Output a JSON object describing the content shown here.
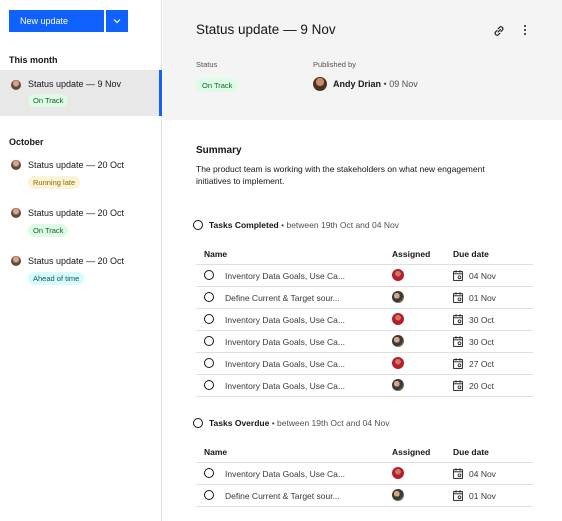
{
  "sidebar": {
    "new_button_label": "New update",
    "sections": [
      {
        "title": "This month",
        "items": [
          {
            "title": "Status update — 9 Nov",
            "tag": "On Track",
            "tag_color": "green",
            "active": true
          }
        ]
      },
      {
        "title": "October",
        "items": [
          {
            "title": "Status update — 20 Oct",
            "tag": "Running late",
            "tag_color": "yellow",
            "active": false
          },
          {
            "title": "Status update — 20 Oct",
            "tag": "On Track",
            "tag_color": "green",
            "active": false
          },
          {
            "title": "Status update — 20 Oct",
            "tag": "Ahead of time",
            "tag_color": "cyan",
            "active": false
          }
        ]
      }
    ]
  },
  "header": {
    "title": "Status update — 9 Nov",
    "status_label": "Status",
    "status_value": "On Track",
    "published_label": "Published by",
    "author": "Andy Drian",
    "date": "09 Nov"
  },
  "summary": {
    "title": "Summary",
    "text": "The product team is working with the stakeholders on what new engagement initiatives to implement."
  },
  "columns": {
    "name": "Name",
    "assigned": "Assigned",
    "due": "Due date"
  },
  "groups": [
    {
      "title": "Tasks Completed",
      "subtitle": "between 19th Oct and 04 Nov",
      "rows": [
        {
          "task": "Inventory Data Goals, Use Ca...",
          "avatar": "a1",
          "due": "04 Nov"
        },
        {
          "task": "Define Current & Target sour...",
          "avatar": "a2",
          "due": "01 Nov"
        },
        {
          "task": "Inventory Data Goals, Use Ca...",
          "avatar": "a1",
          "due": "30 Oct"
        },
        {
          "task": "Inventory Data Goals, Use Ca...",
          "avatar": "a2",
          "due": "30 Oct"
        },
        {
          "task": "Inventory Data Goals, Use Ca...",
          "avatar": "a1",
          "due": "27 Oct"
        },
        {
          "task": "Inventory Data Goals, Use Ca...",
          "avatar": "a2",
          "due": "20 Oct"
        }
      ]
    },
    {
      "title": "Tasks Overdue",
      "subtitle": "between 19th Oct and 04 Nov",
      "rows": [
        {
          "task": "Inventory Data Goals, Use Ca...",
          "avatar": "a1",
          "due": "04 Nov"
        },
        {
          "task": "Define Current & Target sour...",
          "avatar": "a2",
          "due": "01 Nov"
        }
      ]
    }
  ],
  "icons": {
    "caret": "chevron-down-icon",
    "link": "link-icon",
    "more": "overflow-menu-icon",
    "calendar": "calendar-icon",
    "checkbox": "circle-icon"
  },
  "colors": {
    "accent": "#0f62fe",
    "green_tag_bg": "#defbe6",
    "yellow_tag_bg": "#fcf4d6",
    "cyan_tag_bg": "#d9fbfb"
  }
}
